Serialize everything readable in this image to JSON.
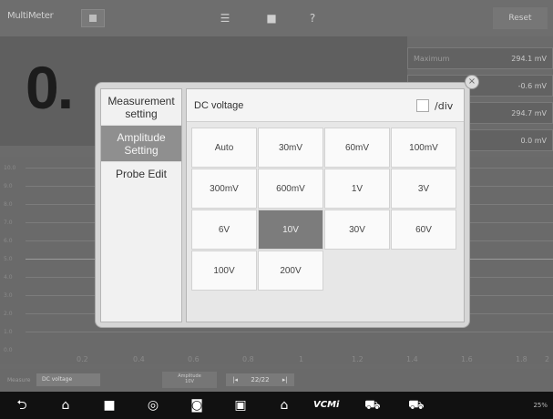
{
  "app": {
    "title": "MultiMeter",
    "reset_label": "Reset"
  },
  "reading": {
    "value": "0."
  },
  "stats": [
    {
      "label": "Maximum",
      "value": "294.1 mV"
    },
    {
      "label": "",
      "value": "-0.6 mV"
    },
    {
      "label": "",
      "value": "294.7 mV"
    },
    {
      "label": "",
      "value": "0.0 mV"
    }
  ],
  "graph": {
    "y_labels": [
      "10.0",
      "9.0",
      "8.0",
      "7.0",
      "6.0",
      "5.0",
      "4.0",
      "3.0",
      "2.0",
      "1.0",
      "0.0"
    ],
    "x_labels": [
      "0.2",
      "0.4",
      "0.6",
      "0.8",
      "1",
      "1.2",
      "1.4",
      "1.6",
      "1.8",
      "2"
    ]
  },
  "controls": {
    "measure_label": "Measure",
    "measure_value": "DC voltage",
    "amplitude_label": "Amplitude",
    "amplitude_value": "10V",
    "page": "22/22"
  },
  "dialog": {
    "menu": [
      {
        "label": "Measurement setting"
      },
      {
        "label": "Amplitude Setting"
      },
      {
        "label": "Probe Edit"
      }
    ],
    "title": "DC voltage",
    "div_label": "/div",
    "options": [
      "Auto",
      "30mV",
      "60mV",
      "100mV",
      "300mV",
      "600mV",
      "1V",
      "3V",
      "6V",
      "10V",
      "30V",
      "60V",
      "100V",
      "200V"
    ],
    "selected": "10V"
  },
  "navbar": {
    "icons": [
      "back-icon",
      "home-icon",
      "recent-apps-icon",
      "chrome-icon",
      "camera-icon",
      "screen-capture-icon",
      "house-icon",
      "vcm-icon",
      "car-icon",
      "car-network-icon"
    ],
    "vcm_text": "VCMi",
    "status": "25%"
  }
}
